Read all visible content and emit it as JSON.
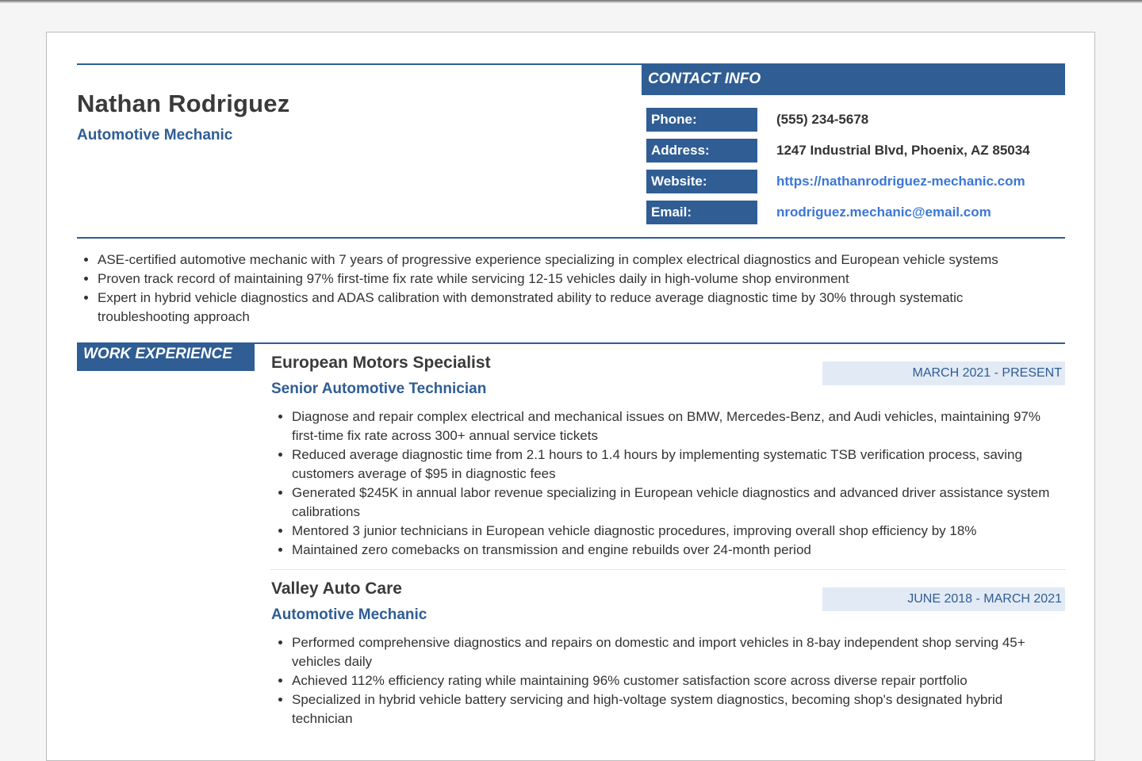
{
  "header": {
    "name": "Nathan Rodriguez",
    "headline": "Automotive Mechanic"
  },
  "contact": {
    "title": "CONTACT INFO",
    "rows": [
      {
        "label": "Phone:",
        "value": "(555) 234-5678"
      },
      {
        "label": "Address:",
        "value": "1247 Industrial Blvd, Phoenix, AZ 85034"
      },
      {
        "label": "Website:",
        "value": "https://nathanrodriguez-mechanic.com"
      },
      {
        "label": "Email:",
        "value": "nrodriguez.mechanic@email.com"
      }
    ]
  },
  "summary": [
    "ASE-certified automotive mechanic with 7 years of progressive experience specializing in complex electrical diagnostics and European vehicle systems",
    "Proven track record of maintaining 97% first-time fix rate while servicing 12-15 vehicles daily in high-volume shop environment",
    "Expert in hybrid vehicle diagnostics and ADAS calibration with demonstrated ability to reduce average diagnostic time by 30% through systematic troubleshooting approach"
  ],
  "experience": {
    "heading": "WORK EXPERIENCE",
    "jobs": [
      {
        "company": "European Motors Specialist",
        "role": "Senior Automotive Technician",
        "dates": "MARCH 2021 - PRESENT",
        "bullets": [
          "Diagnose and repair complex electrical and mechanical issues on BMW, Mercedes-Benz, and Audi vehicles, maintaining 97% first-time fix rate across 300+ annual service tickets",
          "Reduced average diagnostic time from 2.1 hours to 1.4 hours by implementing systematic TSB verification process, saving customers average of $95 in diagnostic fees",
          "Generated $245K in annual labor revenue specializing in European vehicle diagnostics and advanced driver assistance system calibrations",
          "Mentored 3 junior technicians in European vehicle diagnostic procedures, improving overall shop efficiency by 18%",
          "Maintained zero comebacks on transmission and engine rebuilds over 24-month period"
        ]
      },
      {
        "company": "Valley Auto Care",
        "role": "Automotive Mechanic",
        "dates": "JUNE 2018 - MARCH 2021",
        "bullets": [
          "Performed comprehensive diagnostics and repairs on domestic and import vehicles in 8-bay independent shop serving 45+ vehicles daily",
          "Achieved 112% efficiency rating while maintaining 96% customer satisfaction score across diverse repair portfolio",
          "Specialized in hybrid vehicle battery servicing and high-voltage system diagnostics, becoming shop's designated hybrid technician"
        ]
      }
    ]
  }
}
